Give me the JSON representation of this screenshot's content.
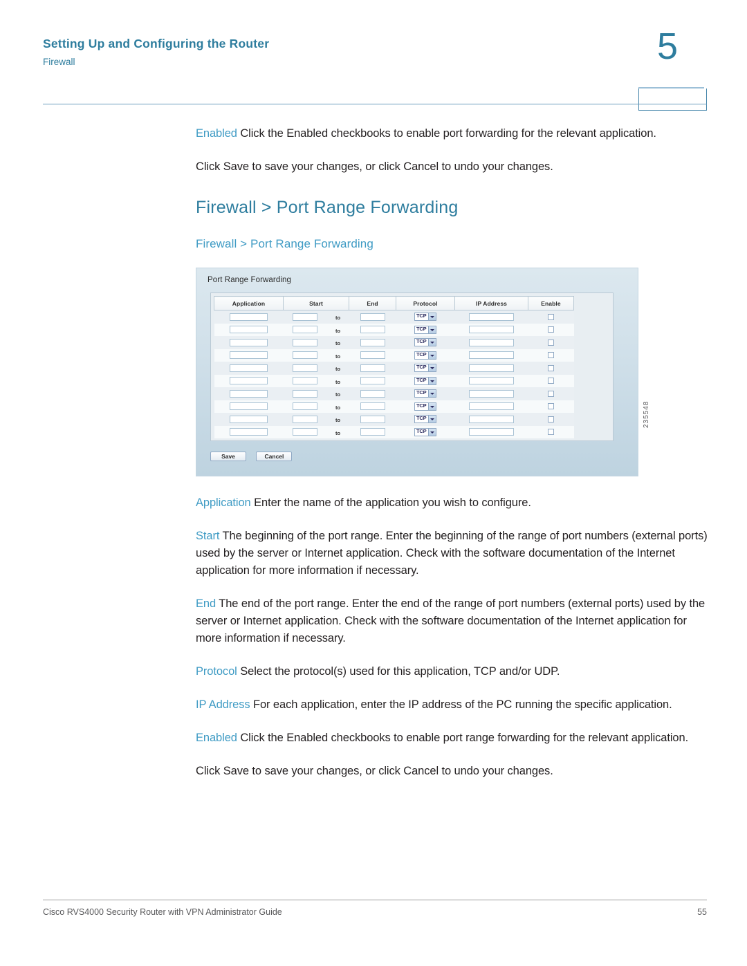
{
  "header": {
    "chapter_title": "Setting Up and Configuring the Router",
    "section_title": "Firewall",
    "chapter_number": "5"
  },
  "content": {
    "intro_paragraphs": [
      {
        "term": "Enabled",
        "text": " Click the Enabled checkbooks to enable port forwarding for the relevant application."
      },
      {
        "term": "",
        "text": "Click Save to save your changes, or click Cancel to undo your changes."
      }
    ],
    "section_head": "Firewall > Port Range Forwarding",
    "sub_head": "Firewall > Port Range Forwarding",
    "definitions": [
      {
        "term": "Application",
        "text": " Enter the name of the application you wish to configure."
      },
      {
        "term": "Start",
        "text": " The beginning of the port range. Enter the beginning of the range of port numbers (external ports) used by the server or Internet application. Check with the software documentation of the Internet application for more information if necessary."
      },
      {
        "term": "End",
        "text": " The end of the port range. Enter the end of the range of port numbers (external ports) used by the server or Internet application. Check with the software documentation of the Internet application for more information if necessary."
      },
      {
        "term": "Protocol",
        "text": " Select the protocol(s) used for this application, TCP and/or UDP."
      },
      {
        "term": "IP Address",
        "text": " For each application, enter the IP address of the PC running the specific application."
      },
      {
        "term": "Enabled",
        "text": " Click the Enabled checkbooks to enable port range forwarding for the relevant application."
      },
      {
        "term": "",
        "text": "Click Save to save your changes, or click Cancel to undo your changes."
      }
    ]
  },
  "figure": {
    "id": "235548",
    "screenshot": {
      "panel_title": "Port Range Forwarding",
      "columns": [
        "Application",
        "Start",
        "End",
        "Protocol",
        "IP Address",
        "Enable"
      ],
      "range_separator": "to",
      "protocol_value": "TCP",
      "row_count": 10,
      "rows": [
        {
          "application": "",
          "start": "",
          "end": "",
          "protocol": "TCP",
          "ip_address": "",
          "enable": false
        },
        {
          "application": "",
          "start": "",
          "end": "",
          "protocol": "TCP",
          "ip_address": "",
          "enable": false
        },
        {
          "application": "",
          "start": "",
          "end": "",
          "protocol": "TCP",
          "ip_address": "",
          "enable": false
        },
        {
          "application": "",
          "start": "",
          "end": "",
          "protocol": "TCP",
          "ip_address": "",
          "enable": false
        },
        {
          "application": "",
          "start": "",
          "end": "",
          "protocol": "TCP",
          "ip_address": "",
          "enable": false
        },
        {
          "application": "",
          "start": "",
          "end": "",
          "protocol": "TCP",
          "ip_address": "",
          "enable": false
        },
        {
          "application": "",
          "start": "",
          "end": "",
          "protocol": "TCP",
          "ip_address": "",
          "enable": false
        },
        {
          "application": "",
          "start": "",
          "end": "",
          "protocol": "TCP",
          "ip_address": "",
          "enable": false
        },
        {
          "application": "",
          "start": "",
          "end": "",
          "protocol": "TCP",
          "ip_address": "",
          "enable": false
        },
        {
          "application": "",
          "start": "",
          "end": "",
          "protocol": "TCP",
          "ip_address": "",
          "enable": false
        }
      ],
      "save_label": "Save",
      "cancel_label": "Cancel"
    }
  },
  "footer": {
    "document_title": "Cisco RVS4000 Security Router with VPN Administrator Guide",
    "page_number": "55"
  },
  "colors": {
    "heading_blue": "#2e7d9e",
    "term_blue": "#3f9bc4",
    "rule_blue": "#6a9cbd",
    "body_text": "#231f20",
    "footer_gray": "#58585a"
  }
}
